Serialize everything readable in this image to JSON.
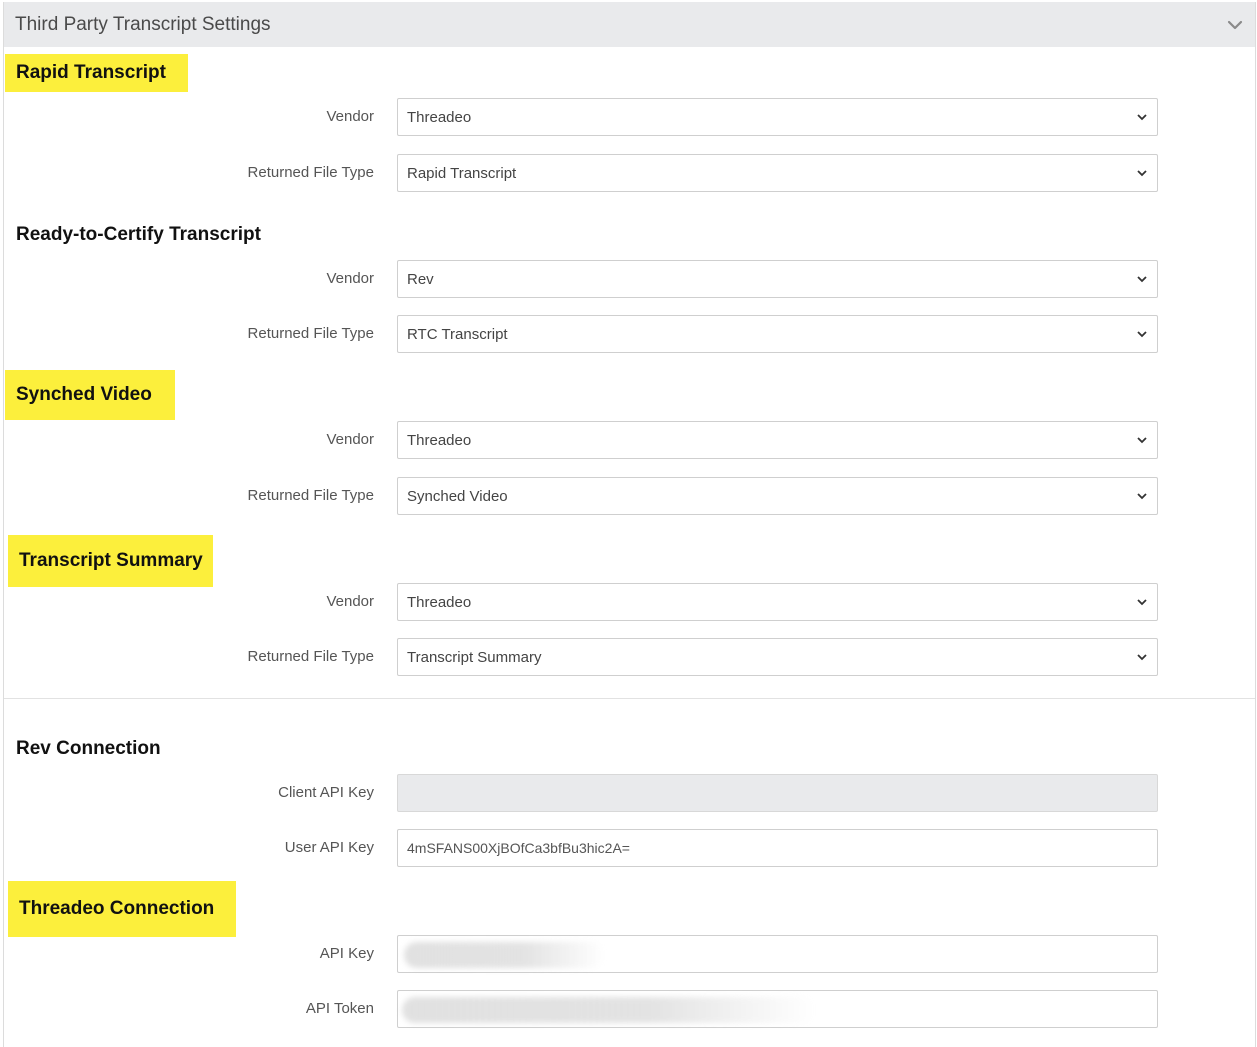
{
  "panel": {
    "title": "Third Party Transcript Settings"
  },
  "sections": {
    "rapid": {
      "title": "Rapid Transcript",
      "vendor_label": "Vendor",
      "vendor_value": "Threadeo",
      "file_type_label": "Returned File Type",
      "file_type_value": "Rapid Transcript"
    },
    "rtc": {
      "title": "Ready-to-Certify Transcript",
      "vendor_label": "Vendor",
      "vendor_value": "Rev",
      "file_type_label": "Returned File Type",
      "file_type_value": "RTC Transcript"
    },
    "synched": {
      "title": "Synched Video",
      "vendor_label": "Vendor",
      "vendor_value": "Threadeo",
      "file_type_label": "Returned File Type",
      "file_type_value": "Synched Video"
    },
    "summary": {
      "title": "Transcript Summary",
      "vendor_label": "Vendor",
      "vendor_value": "Threadeo",
      "file_type_label": "Returned File Type",
      "file_type_value": "Transcript Summary"
    }
  },
  "rev_connection": {
    "title": "Rev Connection",
    "client_key_label": "Client API Key",
    "client_key_value": "",
    "user_key_label": "User API Key",
    "user_key_value": "4mSFANS00XjBOfCa3bfBu3hic2A="
  },
  "threadeo_connection": {
    "title": "Threadeo Connection",
    "api_key_label": "API Key",
    "api_token_label": "API Token"
  },
  "colors": {
    "highlight": "#fcef3c",
    "header_bg": "#e9eaec"
  },
  "icons": {
    "collapse": "chevron-down-icon",
    "select": "chevron-down-icon"
  }
}
